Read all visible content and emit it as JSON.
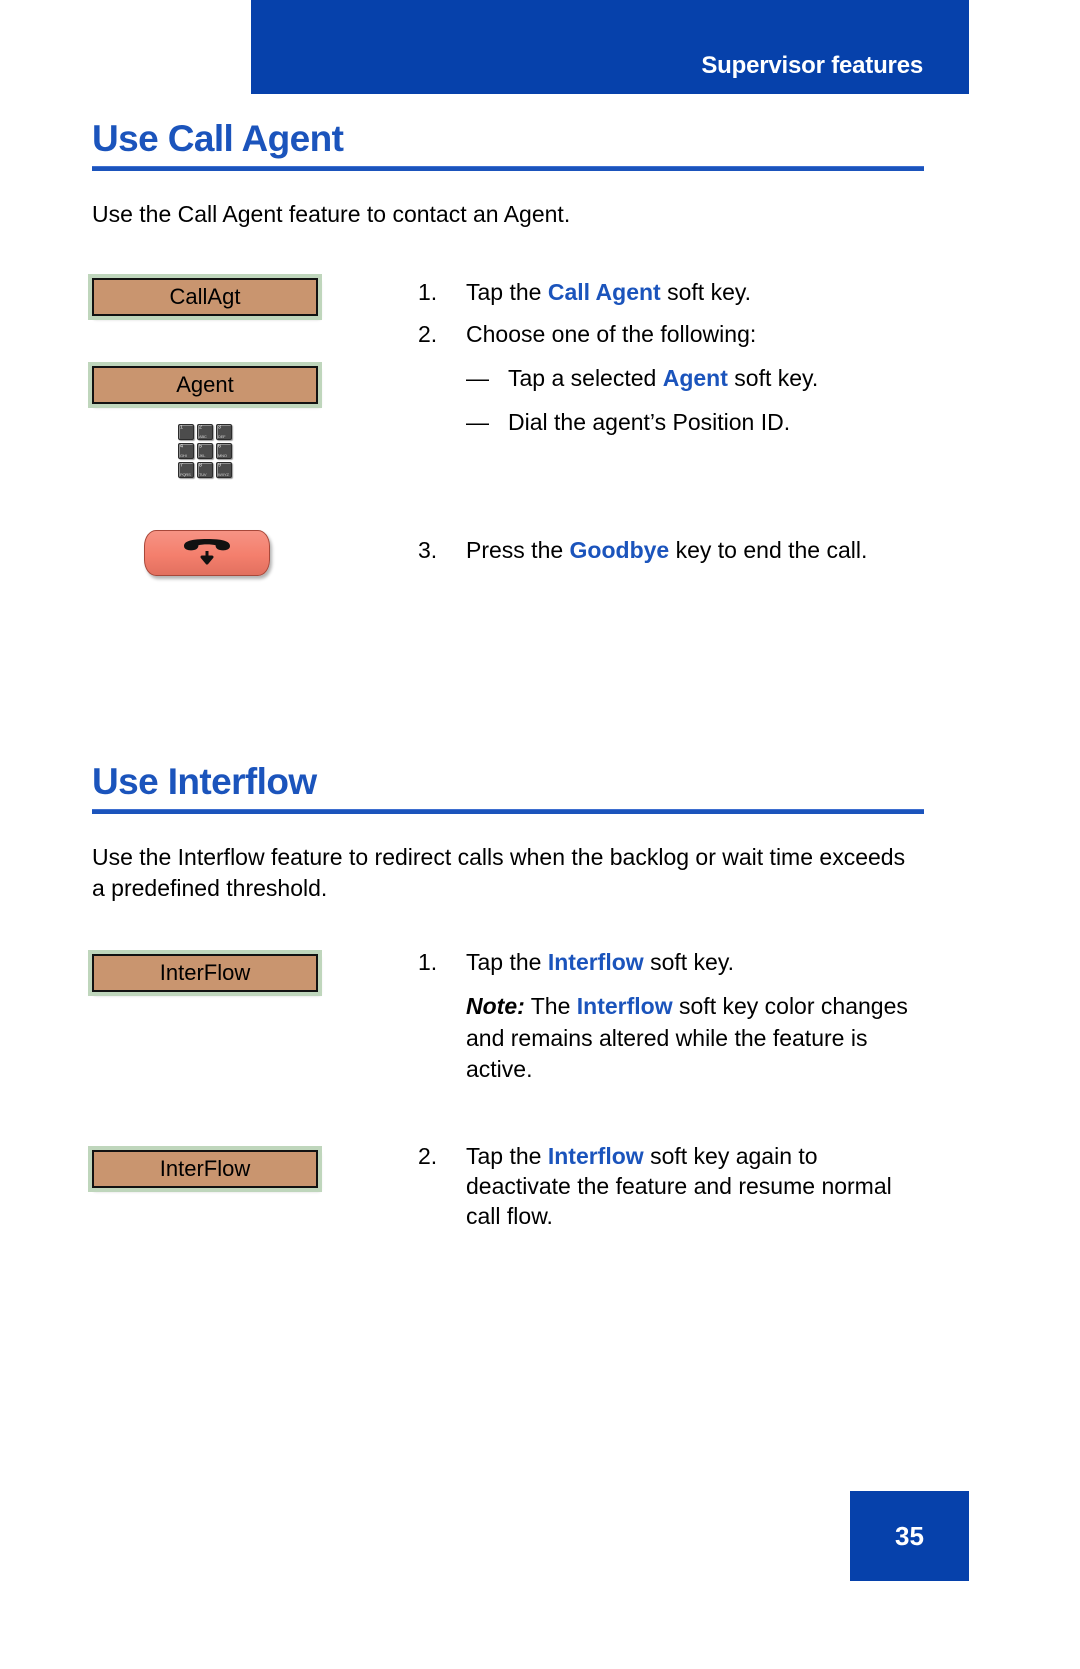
{
  "header": {
    "running_head": "Supervisor features",
    "banner_color": "#0641AB"
  },
  "footer": {
    "page_number": "35",
    "bar_color": "#0641AB"
  },
  "theme": {
    "heading_blue": "#1B54BC",
    "softkey_fill": "#C9956F",
    "softkey_frame": "#BFD6BC",
    "goodbye_key_fill": "#F47F6D"
  },
  "sections": [
    {
      "title": "Use Call Agent",
      "intro": "Use the Call Agent feature to contact an Agent.",
      "steps": [
        {
          "number": "1.",
          "figure": {
            "type": "softkey",
            "label": "CallAgt"
          },
          "text_parts": [
            {
              "t": "Tap the ",
              "style": "plain"
            },
            {
              "t": "Call Agent",
              "style": "bold-blue"
            },
            {
              "t": " soft key.",
              "style": "plain"
            }
          ]
        },
        {
          "number": "2.",
          "figure": {
            "type": "softkey-keypad",
            "label": "Agent"
          },
          "text_parts": [
            {
              "t": "Choose one of the following:",
              "style": "plain"
            }
          ],
          "subitems": [
            {
              "marker": "—",
              "parts": [
                {
                  "t": "Tap a selected ",
                  "style": "plain"
                },
                {
                  "t": "Agent",
                  "style": "bold-blue"
                },
                {
                  "t": " soft key.",
                  "style": "plain"
                }
              ]
            },
            {
              "marker": "—",
              "parts": [
                {
                  "t": "Dial the agent’s Position ID.",
                  "style": "plain"
                }
              ]
            }
          ]
        },
        {
          "number": "3.",
          "figure": {
            "type": "goodbye-key",
            "label": "goodbye-key"
          },
          "text_parts": [
            {
              "t": "Press the ",
              "style": "plain"
            },
            {
              "t": "Goodbye",
              "style": "bold-blue"
            },
            {
              "t": " key to end the call.",
              "style": "plain"
            }
          ]
        }
      ]
    },
    {
      "title": "Use Interflow",
      "intro": "Use the Interflow feature to redirect calls when the backlog or wait time exceeds a predefined threshold.",
      "steps": [
        {
          "number": "1.",
          "figure": {
            "type": "softkey",
            "label": "InterFlow"
          },
          "text_parts": [
            {
              "t": "Tap the ",
              "style": "plain"
            },
            {
              "t": "Interflow",
              "style": "bold-blue"
            },
            {
              "t": " soft key.",
              "style": "plain"
            }
          ],
          "note": {
            "label": "Note:",
            "parts": [
              {
                "t": " The ",
                "style": "plain"
              },
              {
                "t": "Interflow",
                "style": "bold-blue"
              },
              {
                "t": " soft key color changes and remains altered while the feature is active.",
                "style": "plain"
              }
            ]
          }
        },
        {
          "number": "2.",
          "figure": {
            "type": "softkey",
            "label": "InterFlow"
          },
          "text_parts": [
            {
              "t": "Tap the ",
              "style": "plain"
            },
            {
              "t": "Interflow",
              "style": "bold-blue"
            },
            {
              "t": " soft key again to deactivate the feature and resume normal call flow.",
              "style": "plain"
            }
          ]
        }
      ]
    }
  ],
  "keypad": {
    "keys": [
      {
        "digit": "1",
        "letters": ""
      },
      {
        "digit": "2",
        "letters": "ABC"
      },
      {
        "digit": "3",
        "letters": "DEF"
      },
      {
        "digit": "4",
        "letters": "GHI"
      },
      {
        "digit": "5",
        "letters": "JKL"
      },
      {
        "digit": "6",
        "letters": "MNO"
      },
      {
        "digit": "7",
        "letters": "PQRS"
      },
      {
        "digit": "8",
        "letters": "TUV"
      },
      {
        "digit": "9",
        "letters": "WXYZ"
      }
    ]
  }
}
